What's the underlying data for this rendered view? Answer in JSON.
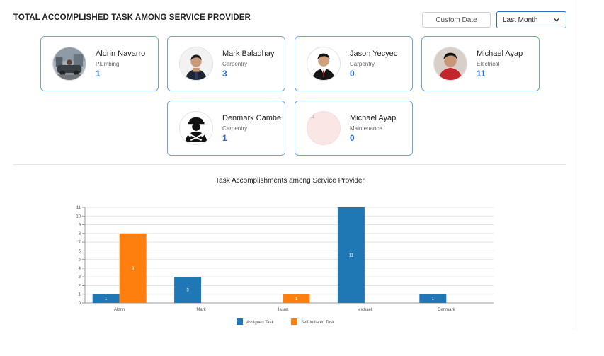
{
  "header": {
    "title": "TOTAL ACCOMPLISHED TASK AMONG SERVICE PROVIDER",
    "custom_date_label": "Custom Date",
    "period_selected": "Last Month"
  },
  "providers": [
    {
      "name": "Aldrin Navarro",
      "category": "Plumbing",
      "count": "1"
    },
    {
      "name": "Mark Baladhay",
      "category": "Carpentry",
      "count": "3"
    },
    {
      "name": "Jason Yecyec",
      "category": "Carpentry",
      "count": "0"
    },
    {
      "name": "Michael Ayap",
      "category": "Electrical",
      "count": "11"
    },
    {
      "name": "Denmark Cambe",
      "category": "Carpentry",
      "count": "1"
    },
    {
      "name": "Michael Ayap",
      "category": "Maintenance",
      "count": "0"
    }
  ],
  "chart_title": "Task Accomplishments among Service Provider",
  "chart_data": {
    "type": "bar",
    "title": "Task Accomplishments among Service Provider",
    "categories": [
      "Aldrin",
      "Mark",
      "Jason",
      "Michael",
      "Denmark"
    ],
    "series": [
      {
        "name": "Assigned Task",
        "color": "#1f77b4",
        "values": [
          1,
          3,
          0,
          11,
          1
        ]
      },
      {
        "name": "Self-Initiated Task",
        "color": "#ff7f0e",
        "values": [
          8,
          0,
          1,
          0,
          0
        ]
      }
    ],
    "ylim": [
      0,
      11
    ],
    "yticks": [
      0,
      1,
      2,
      3,
      4,
      5,
      6,
      7,
      8,
      9,
      10,
      11
    ],
    "grid": true,
    "legend": "bottom-center",
    "data_labels": true
  }
}
